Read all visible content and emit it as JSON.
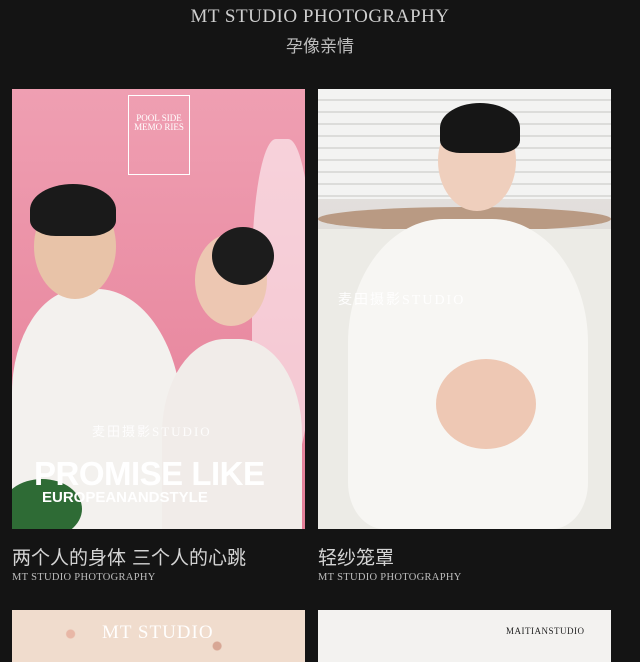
{
  "header": {
    "brand": "MT STUDIO PHOTOGRAPHY",
    "subtitle": "孕像亲情"
  },
  "cards": [
    {
      "title": "两个人的身体 三个人的心跳",
      "subtitle": "MT STUDIO PHOTOGRAPHY",
      "image": {
        "box_text": "POOL SIDE MEMO RIES",
        "watermark": "麦田摄影STUDIO",
        "headline": "PROMISE LIKE",
        "subheadline": "EUROPEANANDSTYLE"
      }
    },
    {
      "title": "轻纱笼罩",
      "subtitle": "MT STUDIO PHOTOGRAPHY",
      "image": {
        "watermark": "麦田摄影STUDIO"
      }
    },
    {
      "image": {
        "watermark": "MT STUDIO"
      }
    },
    {
      "image": {
        "watermark": "MAITIANSTUDIO"
      }
    }
  ],
  "colors": {
    "background": "#141414",
    "pink_photo": "#ea8ea4"
  }
}
